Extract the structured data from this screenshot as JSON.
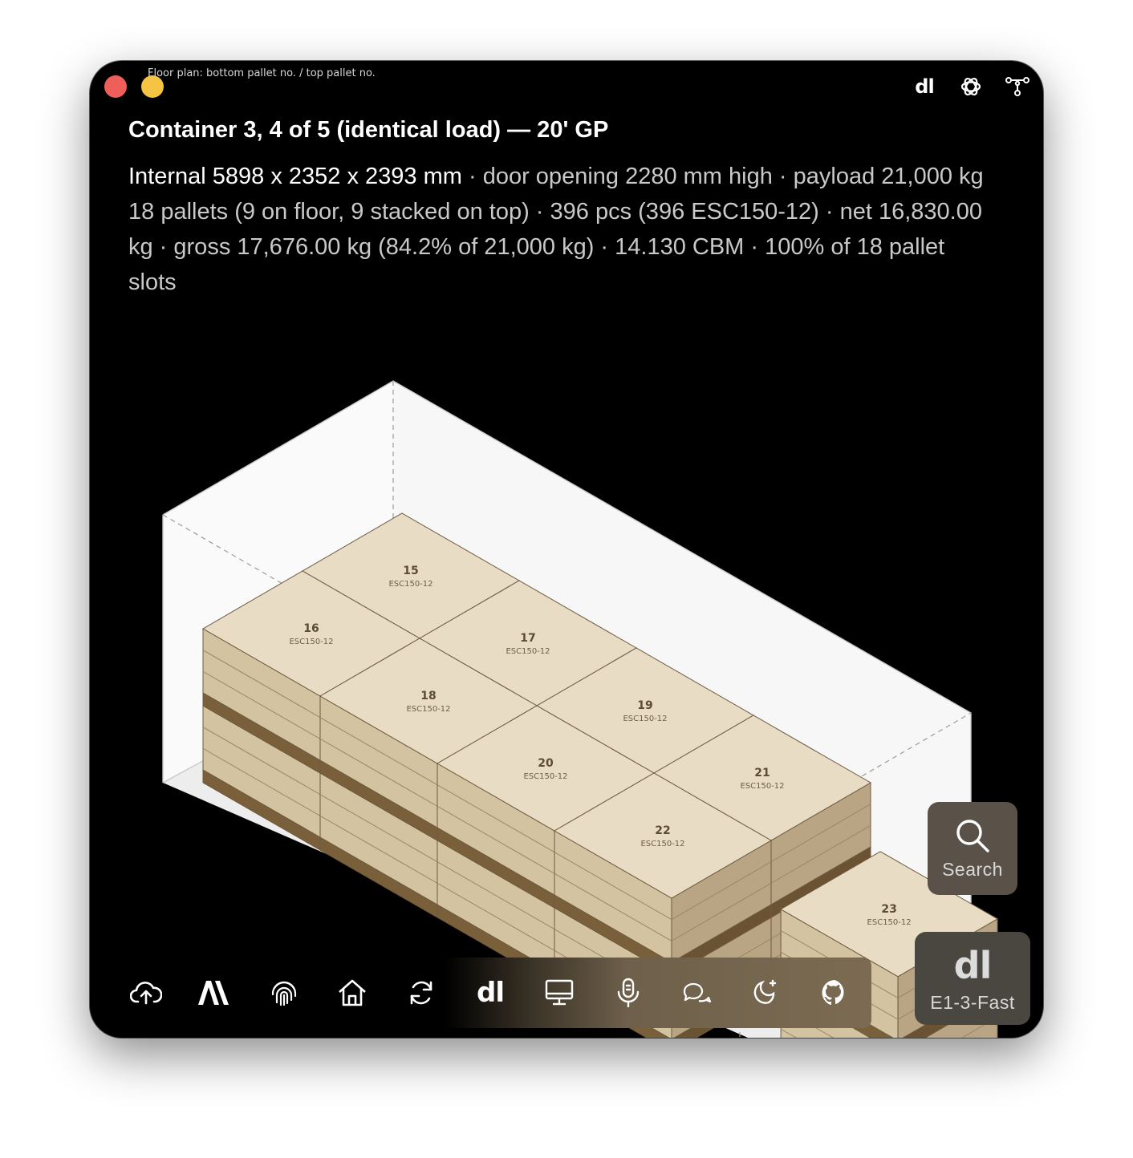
{
  "window": {
    "caption": "Floor plan: bottom pallet no. / top pallet no."
  },
  "header": {
    "title": "Container 3, 4 of 5 (identical load) — 20' GP",
    "dims": "Internal 5898 x 2352 x 2393 mm",
    "specs": " · door opening 2280 mm high · payload 21,000 kg",
    "summary": "18 pallets (9 on floor, 9 stacked on top) · 396 pcs (396 ESC150-12) · net 16,830.00 kg · gross 17,676.00 kg (84.2% of 21,000 kg) · 14.130 CBM · 100% of 18 pallet slots"
  },
  "toolbar_right": {
    "dl_label": "dl",
    "icons": [
      "dl-icon",
      "openai-icon",
      "graph-nodes-icon"
    ]
  },
  "pallets": [
    {
      "no": "15",
      "sku": "ESC150-12"
    },
    {
      "no": "16",
      "sku": "ESC150-12"
    },
    {
      "no": "17",
      "sku": "ESC150-12"
    },
    {
      "no": "18",
      "sku": "ESC150-12"
    },
    {
      "no": "19",
      "sku": "ESC150-12"
    },
    {
      "no": "20",
      "sku": "ESC150-12"
    },
    {
      "no": "21",
      "sku": "ESC150-12"
    },
    {
      "no": "22",
      "sku": "ESC150-12"
    },
    {
      "no": "23",
      "sku": "ESC150-12"
    }
  ],
  "dock": {
    "dl_label": "dl",
    "items": [
      "cloud-upload-icon",
      "anthropic-icon",
      "fingerprint-icon",
      "home-icon",
      "sync-icon",
      "dl-icon",
      "monitor-icon",
      "microphone-icon",
      "chat-icon",
      "night-mode-icon",
      "github-icon"
    ]
  },
  "side": {
    "search_label": "Search",
    "model_label": "E1-3-Fast",
    "model_logo": "dl"
  },
  "colors": {
    "box_top": "#e8dcc4",
    "box_left": "#d4c3a1",
    "box_right": "#b9a584",
    "pallet_wood": "#8d7048",
    "container_wall": "#f6f6f6",
    "traffic_red": "#ee5f5a",
    "traffic_yellow": "#f5c443"
  }
}
